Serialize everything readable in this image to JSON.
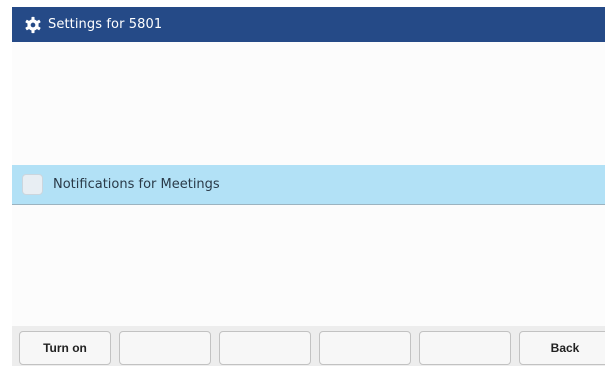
{
  "header": {
    "icon": "gear-icon",
    "title": "Settings for 5801",
    "background_color": "#254a87"
  },
  "list": {
    "items": [
      {
        "label": "Notifications for Meetings",
        "checked": false,
        "selected": true,
        "highlight_color": "#b2e1f6"
      }
    ]
  },
  "softkeys": [
    {
      "label": "Turn on"
    },
    {
      "label": ""
    },
    {
      "label": ""
    },
    {
      "label": ""
    },
    {
      "label": ""
    },
    {
      "label": "Back"
    }
  ]
}
